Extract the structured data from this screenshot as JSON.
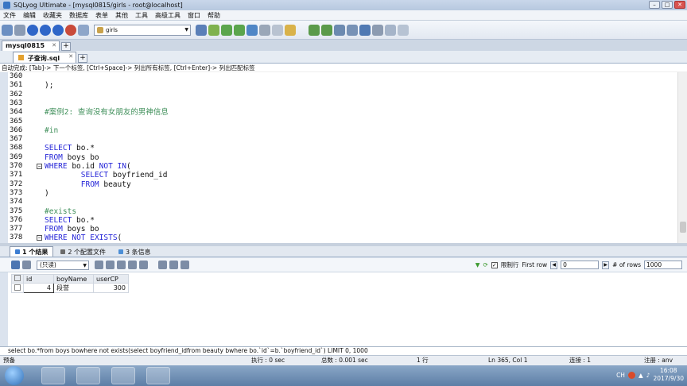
{
  "window": {
    "title": "SQLyog Ultimate - [mysql0815/girls - root@localhost]"
  },
  "menu": [
    "文件",
    "编辑",
    "收藏夹",
    "数据库",
    "表单",
    "其他",
    "工具",
    "高级工具",
    "窗口",
    "帮助"
  ],
  "toolbar": {
    "database": "girls"
  },
  "connection_tab": "mysql0815",
  "query_tab": "子查询.sql",
  "hint": "自动完成: [Tab]-> 下一个标签, [Ctrl+Space]-> 列出所有标签, [Ctrl+Enter]-> 列出匹配标签",
  "editor": {
    "lines": [
      {
        "n": "360",
        "parts": []
      },
      {
        "n": "361",
        "parts": [
          {
            "t": ");",
            "c": "tx"
          }
        ]
      },
      {
        "n": "362",
        "parts": []
      },
      {
        "n": "363",
        "parts": []
      },
      {
        "n": "364",
        "parts": [
          {
            "t": "#案例2: 查询没有女朋友的男神信息",
            "c": "cm"
          }
        ]
      },
      {
        "n": "365",
        "parts": []
      },
      {
        "n": "366",
        "parts": [
          {
            "t": "#in",
            "c": "cm"
          }
        ]
      },
      {
        "n": "367",
        "parts": []
      },
      {
        "n": "368",
        "parts": [
          {
            "t": "SELECT",
            "c": "kw"
          },
          {
            "t": " bo.*",
            "c": "tx"
          }
        ]
      },
      {
        "n": "369",
        "parts": [
          {
            "t": "FROM",
            "c": "kw"
          },
          {
            "t": " boys bo",
            "c": "tx"
          }
        ]
      },
      {
        "n": "370",
        "fold": true,
        "parts": [
          {
            "t": "WHERE",
            "c": "kw"
          },
          {
            "t": " bo.id ",
            "c": "tx"
          },
          {
            "t": "NOT IN",
            "c": "kw"
          },
          {
            "t": "(",
            "c": "tx"
          }
        ]
      },
      {
        "n": "371",
        "parts": [
          {
            "t": "        SELECT",
            "c": "kw"
          },
          {
            "t": " boyfriend_id",
            "c": "tx"
          }
        ]
      },
      {
        "n": "372",
        "parts": [
          {
            "t": "        FROM",
            "c": "kw"
          },
          {
            "t": " beauty",
            "c": "tx"
          }
        ]
      },
      {
        "n": "373",
        "parts": [
          {
            "t": ")",
            "c": "tx"
          }
        ]
      },
      {
        "n": "374",
        "parts": []
      },
      {
        "n": "375",
        "parts": [
          {
            "t": "#exists",
            "c": "cm"
          }
        ]
      },
      {
        "n": "376",
        "parts": [
          {
            "t": "SELECT",
            "c": "kw"
          },
          {
            "t": " bo.*",
            "c": "tx"
          }
        ]
      },
      {
        "n": "377",
        "parts": [
          {
            "t": "FROM",
            "c": "kw"
          },
          {
            "t": " boys bo",
            "c": "tx"
          }
        ]
      },
      {
        "n": "378",
        "fold": true,
        "parts": [
          {
            "t": "WHERE",
            "c": "kw"
          },
          {
            "t": " ",
            "c": "tx"
          },
          {
            "t": "NOT EXISTS",
            "c": "kw"
          },
          {
            "t": "(",
            "c": "tx"
          }
        ]
      }
    ]
  },
  "result_tabs": [
    "1 个结果",
    "2 个配置文件",
    "3 条信息"
  ],
  "result_toolbar": {
    "mode": "(只读)",
    "limit_label": "限制行",
    "first_row_label": "First row",
    "first_row": "0",
    "rows_label": "# of rows",
    "rows": "1000"
  },
  "grid": {
    "columns": [
      "id",
      "boyName",
      "userCP"
    ],
    "rows": [
      {
        "id": "4",
        "boyName": "段誉",
        "userCP": "300"
      }
    ]
  },
  "sql_status": "select bo.*from boys bowhere not exists(select boyfriend_idfrom beauty bwhere bo.`id`=b.`boyfriend_id`) LIMIT 0, 1000",
  "status": {
    "ready": "预备",
    "exec": "执行 : 0 sec",
    "total": "总数 : 0.001 sec",
    "rows": "1 行",
    "pos": "Ln 365, Col 1",
    "conn": "连接 : 1",
    "reg": "注册 : anv"
  },
  "tray": {
    "lang": "CH",
    "time": "16:08",
    "date": "2017/9/30"
  },
  "colors": {
    "keyword": "#2727d8",
    "comment": "#3f8f5a"
  }
}
